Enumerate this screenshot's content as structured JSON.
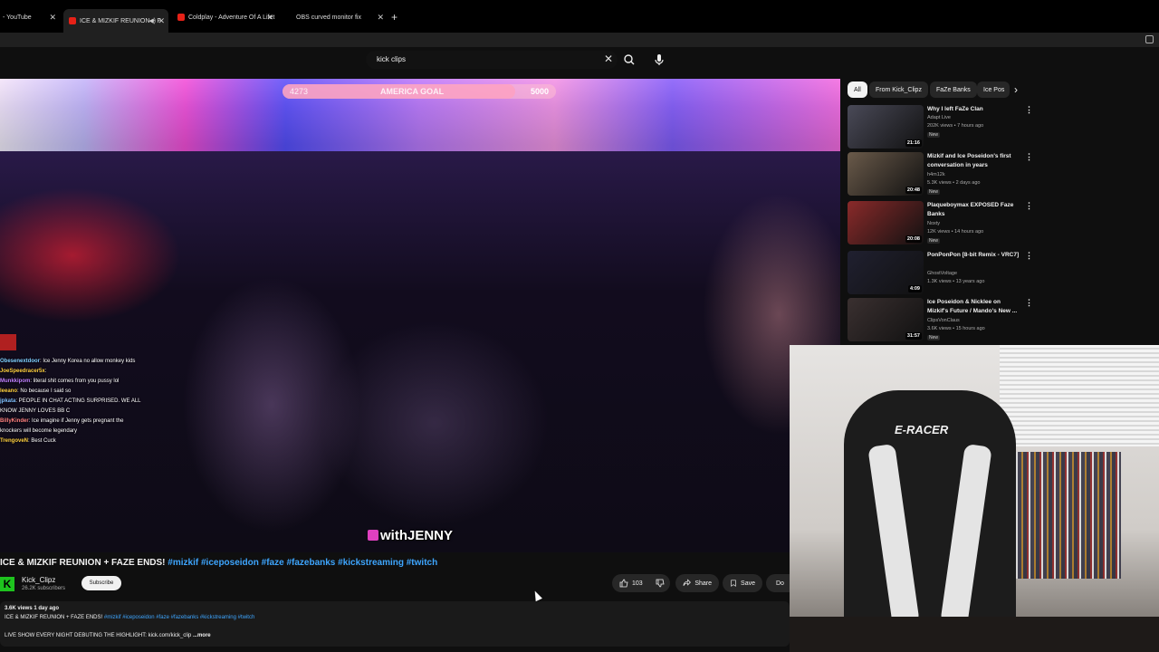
{
  "browser": {
    "tabs": [
      {
        "label": "- YouTube",
        "active": false
      },
      {
        "label": "ICE & MIZKIF REUNION + F",
        "active": true
      },
      {
        "label": "Coldplay - Adventure Of A Lifet",
        "active": false
      },
      {
        "label": "OBS curved monitor fix",
        "active": false
      }
    ],
    "new_tab": "+"
  },
  "search": {
    "query": "kick clips",
    "clear": "✕"
  },
  "video": {
    "goal": {
      "current": "4273",
      "label": "AMERICA GOAL",
      "target": "5000",
      "progress": 0.85
    },
    "chat": [
      {
        "user": "Obesenextdoor",
        "text": ": Ice Jenny Korea no allow monkey kids"
      },
      {
        "user": "JoeSpeedracer5x",
        "text": ":"
      },
      {
        "user": "Munkkipom",
        "text": ": literal shit comes from you pussy lol"
      },
      {
        "user": "leeano",
        "text": ": No because I said so"
      },
      {
        "user": "jpkata",
        "text": ": PEOPLE IN CHAT ACTING SURPRISED. WE ALL KNOW JENNY LOVES BB C"
      },
      {
        "user": "BillyKinder",
        "text": ": Ice imagine if Jenny gets pregnant the knockers will become legendary"
      },
      {
        "user": "TrengoveN",
        "text": ": Best Cuck"
      }
    ],
    "watermark": "withJENNY",
    "title": "ICE & MIZKIF REUNION + FAZE ENDS!",
    "title_tags": "#mizkif #iceposeidon #faze #fazebanks #kickstreaming #twitch"
  },
  "channel": {
    "name": "Kick_Clipz",
    "subscribers": "26.2K subscribers",
    "subscribe": "Subscribe",
    "logo": "K"
  },
  "actions": {
    "likes": "103",
    "share": "Share",
    "save": "Save",
    "download": "Do"
  },
  "description": {
    "meta": "3.6K views  1 day ago",
    "line1": "ICE & MIZKIF REUNION + FAZE ENDS!",
    "line1_tags": "#mizkif #iceposeidon #faze #fazebanks #kickstreaming #twitch",
    "line2": "LIVE SHOW EVERY NIGHT DEBUTING THE HIGHLIGHT: kick.com/kick_clip",
    "more": "...more"
  },
  "sidebar": {
    "chips": [
      "All",
      "From Kick_Clipz",
      "FaZe Banks",
      "Ice Pos"
    ],
    "recommendations": [
      {
        "title": "Why I left FaZe Clan",
        "channel": "Adapt Live",
        "meta": "202K views • 7 hours ago",
        "badge": "New",
        "duration": "21:16",
        "color": "#4a4a58"
      },
      {
        "title": "Mizkif and Ice Poseidon's first conversation in years",
        "channel": "h4m12k",
        "meta": "5.3K views • 2 days ago",
        "badge": "New",
        "duration": "20:48",
        "color": "#6a5a4a"
      },
      {
        "title": "Plaqueboymax EXPOSED Faze Banks",
        "channel": "Noxty",
        "meta": "12K views • 14 hours ago",
        "badge": "New",
        "duration": "20:08",
        "color": "#8a2a2a"
      },
      {
        "title": "PonPonPon [8-bit Remix - VRC7]",
        "channel": "GhostVoltage",
        "meta": "1.3K views • 13 years ago",
        "badge": "",
        "duration": "4:09",
        "color": "#202030"
      },
      {
        "title": "Ice Poseidon & Nicklee on Mizkif's Future / Mando's New ...",
        "channel": "ClipsVonClaus",
        "meta": "3.6K views • 15 hours ago",
        "badge": "New",
        "duration": "31:57",
        "color": "#3a3030"
      }
    ]
  },
  "webcam": {
    "chair_brand": "E-RACER"
  }
}
